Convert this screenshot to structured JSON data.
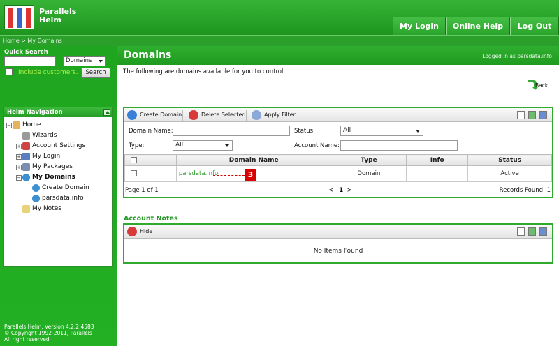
{
  "header": {
    "title_line1": "Parallels",
    "title_line2": "Helm",
    "nav": [
      "My Login",
      "Online Help",
      "Log Out"
    ]
  },
  "breadcrumb": "Home > My Domains",
  "quick_search": {
    "label": "Quick Search",
    "query": "",
    "scope": "Domains",
    "include_label": "Include customers.",
    "search_label": "Search"
  },
  "navigation": {
    "title": "Helm Navigation",
    "items": [
      {
        "label": "Home"
      },
      {
        "label": "Wizards"
      },
      {
        "label": "Account Settings"
      },
      {
        "label": "My Login"
      },
      {
        "label": "My Packages"
      },
      {
        "label": "My Domains"
      },
      {
        "label": "Create Domain"
      },
      {
        "label": "parsdata.info"
      },
      {
        "label": "My Notes"
      }
    ]
  },
  "footer": {
    "line1": "Parallels Helm, Version 4.2.2.4583",
    "line2": "© Copyright 1992-2011, Parallels",
    "line3": "All right reserved"
  },
  "main": {
    "title": "Domains",
    "logged_in": "Logged in as parsdata.info",
    "intro": "The following are domains available for you to control.",
    "back_label": "Back"
  },
  "domains_panel": {
    "toolbar": {
      "create": "Create Domain",
      "delete": "Delete Selected",
      "filter": "Apply Filter"
    },
    "filters": {
      "domain_name_label": "Domain Name:",
      "domain_name_value": "",
      "status_label": "Status:",
      "status_value": "All",
      "type_label": "Type:",
      "type_value": "All",
      "account_name_label": "Account Name:",
      "account_name_value": ""
    },
    "columns": [
      "Domain Name",
      "Type",
      "Info",
      "Status"
    ],
    "rows": [
      {
        "domain": "parsdata.info",
        "type": "Domain",
        "info": "",
        "status": "Active"
      }
    ],
    "page_info": "Page 1 of 1",
    "pager_prev": "<",
    "pager_current": "1",
    "pager_next": ">",
    "records": "Records Found: 1",
    "marker": "3"
  },
  "notes_panel": {
    "title": "Account Notes",
    "hide_label": "Hide",
    "empty_text": "No Items Found"
  },
  "colors": {
    "brand_green": "#22a322",
    "link_green": "#2a9a2a",
    "marker_red": "#d80000"
  }
}
